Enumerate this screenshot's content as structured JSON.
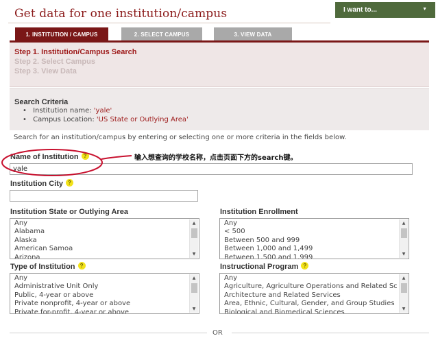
{
  "page": {
    "title": "Get data for one institution/campus"
  },
  "header": {
    "i_want_label": "I want to...",
    "i_want_caret": "▼"
  },
  "tabs": [
    {
      "label": "1. INSTITUTION / CAMPUS",
      "active": true
    },
    {
      "label": "2. SELECT CAMPUS",
      "active": false
    },
    {
      "label": "3. VIEW DATA",
      "active": false
    }
  ],
  "steps": [
    {
      "label": "Step 1. Institution/Campus Search",
      "active": true
    },
    {
      "label": "Step 2. Select Campus",
      "active": false
    },
    {
      "label": "Step 3. View Data",
      "active": false
    }
  ],
  "criteria": {
    "heading": "Search Criteria",
    "items": [
      {
        "label": "Institution name: ",
        "value": "'yale'"
      },
      {
        "label": "Campus Location: ",
        "value": "'US State or Outlying Area'"
      }
    ]
  },
  "intro": "Search for an institution/campus by entering or selecting one or more criteria in the fields below.",
  "form": {
    "help_glyph": "?",
    "institution_name": {
      "label": "Name of Institution",
      "value": "yale"
    },
    "institution_city": {
      "label": "Institution City",
      "value": ""
    },
    "state": {
      "label": "Institution State or Outlying Area",
      "options": [
        "Any",
        "Alabama",
        "Alaska",
        "American Samoa",
        "Arizona"
      ]
    },
    "enrollment": {
      "label": "Institution Enrollment",
      "options": [
        "Any",
        "< 500",
        "Between 500 and 999",
        "Between 1,000 and 1,499",
        "Between 1,500 and 1,999"
      ]
    },
    "type": {
      "label": "Type of Institution",
      "options": [
        "Any",
        "Administrative Unit Only",
        "Public, 4-year or above",
        "Private nonprofit, 4-year or above",
        "Private for-profit, 4-year or above"
      ]
    },
    "program": {
      "label": "Instructional Program",
      "options": [
        "Any",
        "Agriculture, Agriculture Operations and Related Sc",
        "Architecture and Related Services",
        "Area, Ethnic, Cultural, Gender, and Group Studies",
        "Biological and Biomedical Sciences"
      ]
    }
  },
  "separator": "OR",
  "annotation": "输入想查询的学校名称，点击页面下方的search键。",
  "scroll_arrows": {
    "up": "▲",
    "down": "▼"
  },
  "colors": {
    "brand": "#7a1717",
    "accent_text": "#9e1b1b",
    "i_want_bg": "#4f6a3c",
    "help": "#f2e21a",
    "annotation": "#c8102e"
  }
}
